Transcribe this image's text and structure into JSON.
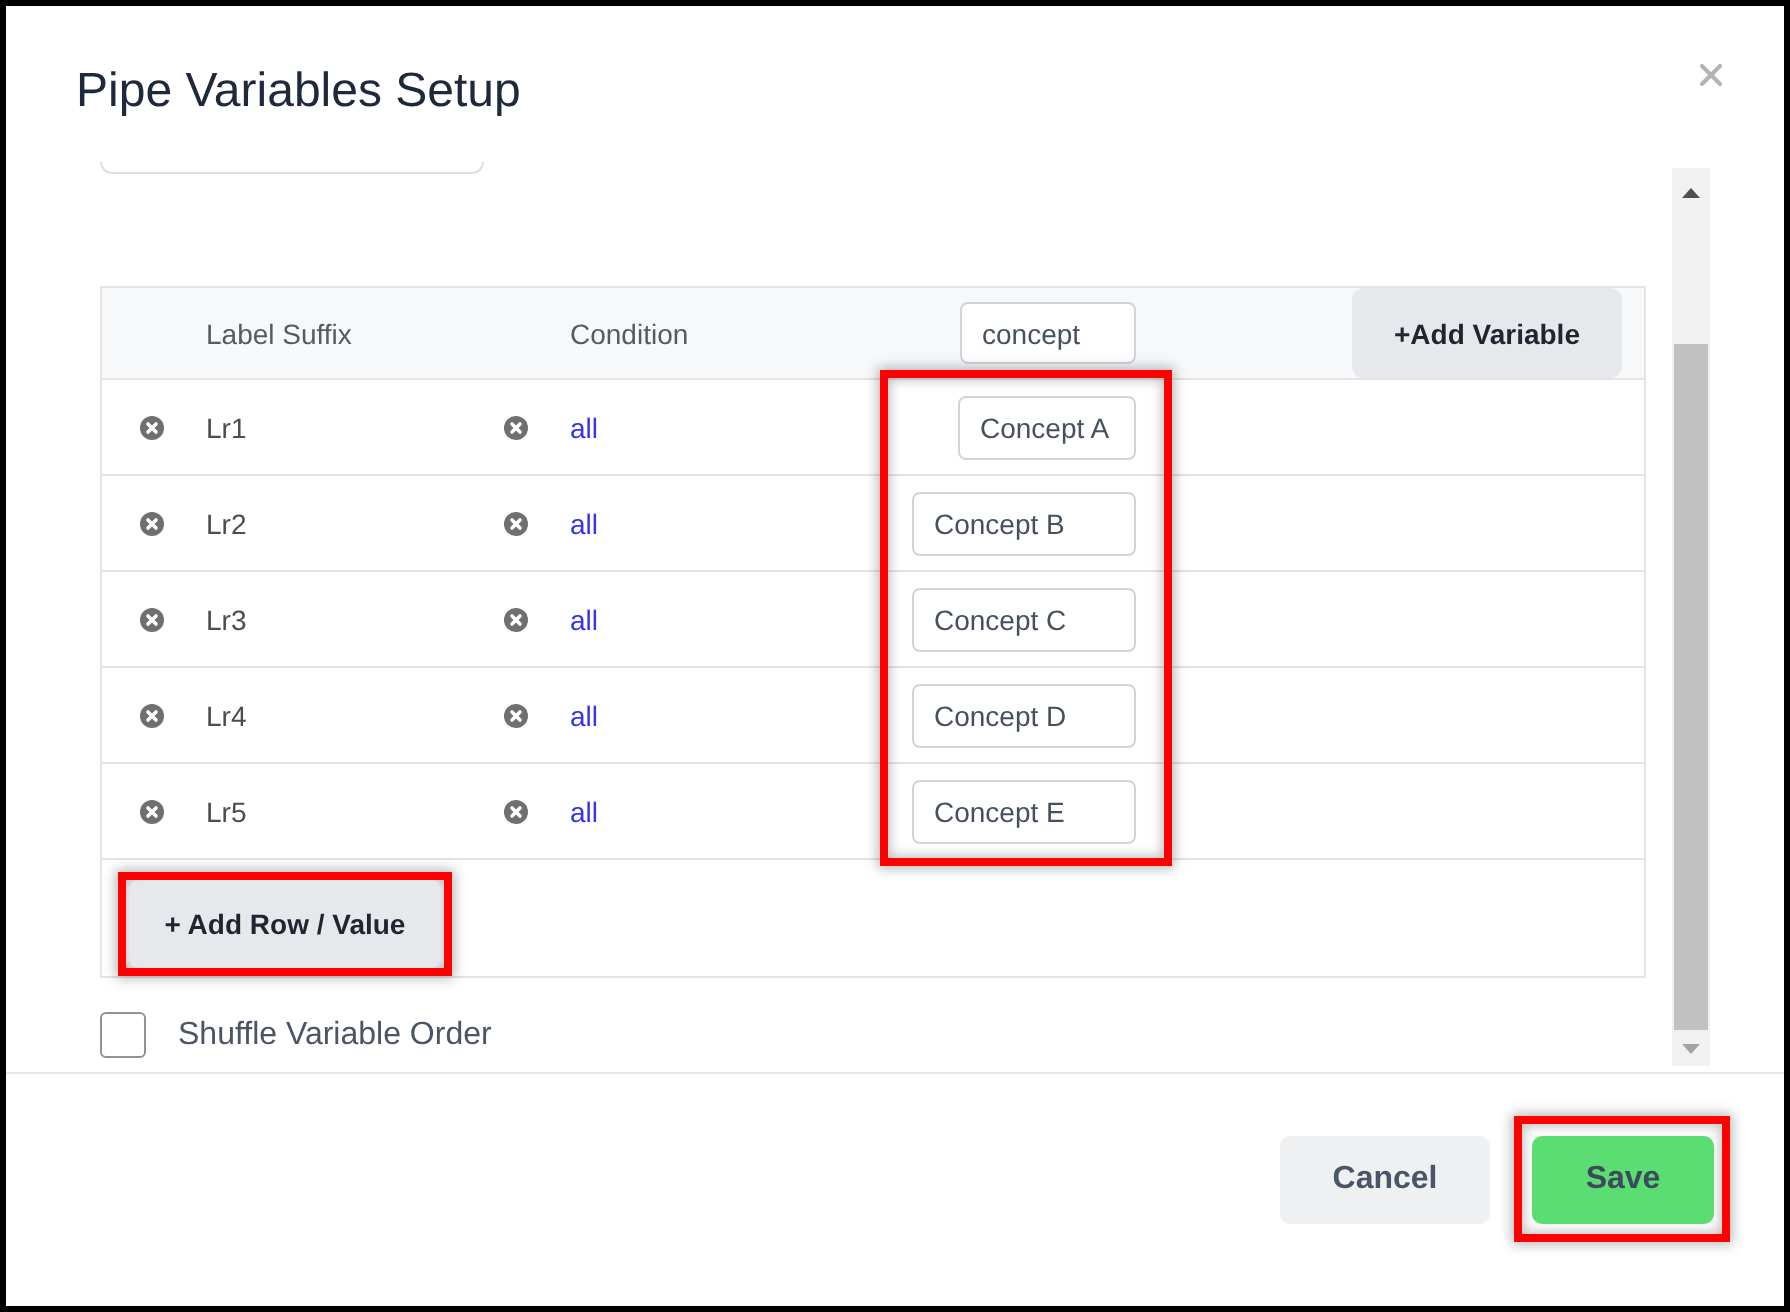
{
  "dialog": {
    "title": "Pipe Variables Setup"
  },
  "table": {
    "columns": [
      {
        "label": "Label Suffix"
      },
      {
        "label": "Condition"
      }
    ],
    "variable_name": "concept",
    "add_variable_button": "+Add Variable",
    "values_highlighted": true,
    "rows": [
      {
        "label": "Lr1",
        "condition": "all",
        "value": "Concept A"
      },
      {
        "label": "Lr2",
        "condition": "all",
        "value": "Concept B"
      },
      {
        "label": "Lr3",
        "condition": "all",
        "value": "Concept C"
      },
      {
        "label": "Lr4",
        "condition": "all",
        "value": "Concept D"
      },
      {
        "label": "Lr5",
        "condition": "all",
        "value": "Concept E"
      }
    ],
    "add_row_button": {
      "label": "+ Add Row / Value",
      "highlighted": true
    }
  },
  "shuffle": {
    "label": "Shuffle Variable Order",
    "checked": false
  },
  "buttons": [
    {
      "label": "Cancel",
      "kind": "secondary",
      "highlighted": false
    },
    {
      "label": "Save",
      "kind": "primary",
      "highlighted": true
    }
  ]
}
